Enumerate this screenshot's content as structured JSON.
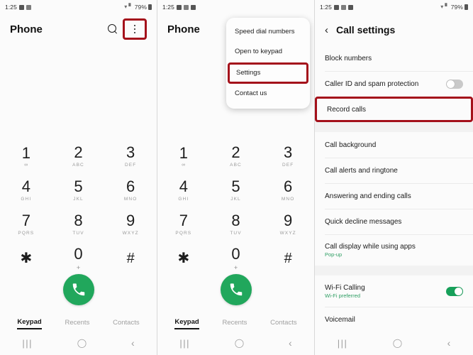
{
  "status_bar": {
    "time": "1:25",
    "icons": [
      "screenshot-icon",
      "camera-icon",
      "app-icon"
    ],
    "wifi": "wifi-icon",
    "signal": "signal-icon",
    "battery_percent": "79%"
  },
  "panel1": {
    "app_title": "Phone",
    "search_icon": "search-icon",
    "menu_icon": "overflow-menu-icon",
    "keys": [
      {
        "digit": "1",
        "sub": "",
        "vm": "voicemail-icon"
      },
      {
        "digit": "2",
        "sub": "ABC",
        "vm": ""
      },
      {
        "digit": "3",
        "sub": "DEF",
        "vm": ""
      },
      {
        "digit": "4",
        "sub": "GHI",
        "vm": ""
      },
      {
        "digit": "5",
        "sub": "JKL",
        "vm": ""
      },
      {
        "digit": "6",
        "sub": "MNO",
        "vm": ""
      },
      {
        "digit": "7",
        "sub": "PQRS",
        "vm": ""
      },
      {
        "digit": "8",
        "sub": "TUV",
        "vm": ""
      },
      {
        "digit": "9",
        "sub": "WXYZ",
        "vm": ""
      },
      {
        "digit": "✱",
        "sub": "",
        "vm": ""
      },
      {
        "digit": "0",
        "sub": "+",
        "vm": ""
      },
      {
        "digit": "#",
        "sub": "",
        "vm": ""
      }
    ],
    "call_button": "call-button",
    "tabs": [
      {
        "label": "Keypad",
        "active": true
      },
      {
        "label": "Recents",
        "active": false
      },
      {
        "label": "Contacts",
        "active": false
      }
    ]
  },
  "panel2": {
    "app_title": "Phone",
    "menu_items": [
      {
        "label": "Speed dial numbers",
        "highlighted": false
      },
      {
        "label": "Open to keypad",
        "highlighted": false
      },
      {
        "label": "Settings",
        "highlighted": true
      },
      {
        "label": "Contact us",
        "highlighted": false
      }
    ],
    "tabs": [
      {
        "label": "Keypad",
        "active": true
      },
      {
        "label": "Recents",
        "active": false
      },
      {
        "label": "Contacts",
        "active": false
      }
    ]
  },
  "panel3": {
    "back_icon": "back-chevron-icon",
    "title": "Call settings",
    "rows": [
      {
        "label": "Block numbers",
        "sub": "",
        "toggle": null,
        "highlighted": false
      },
      {
        "label": "Caller ID and spam protection",
        "sub": "",
        "toggle": "off",
        "highlighted": false
      },
      {
        "label": "Record calls",
        "sub": "",
        "toggle": null,
        "highlighted": true
      },
      {
        "label": "Call background",
        "sub": "",
        "toggle": null,
        "highlighted": false
      },
      {
        "label": "Call alerts and ringtone",
        "sub": "",
        "toggle": null,
        "highlighted": false
      },
      {
        "label": "Answering and ending calls",
        "sub": "",
        "toggle": null,
        "highlighted": false
      },
      {
        "label": "Quick decline messages",
        "sub": "",
        "toggle": null,
        "highlighted": false
      },
      {
        "label": "Call display while using apps",
        "sub": "Pop-up",
        "toggle": null,
        "highlighted": false
      },
      {
        "label": "Wi-Fi Calling",
        "sub": "Wi-Fi preferred",
        "toggle": "on",
        "highlighted": false
      },
      {
        "label": "Voicemail",
        "sub": "",
        "toggle": null,
        "highlighted": false
      }
    ]
  },
  "navbar": {
    "recent_icon": "recent-apps-icon",
    "home_icon": "home-icon",
    "back_icon": "back-icon",
    "recent_glyph": "|||",
    "home_glyph": "◯",
    "back_glyph": "‹"
  },
  "colors": {
    "highlight_red": "#a4111b",
    "call_green": "#21a75c",
    "toggle_on_green": "#17a05a",
    "accent_text_green": "#2e9e63"
  }
}
